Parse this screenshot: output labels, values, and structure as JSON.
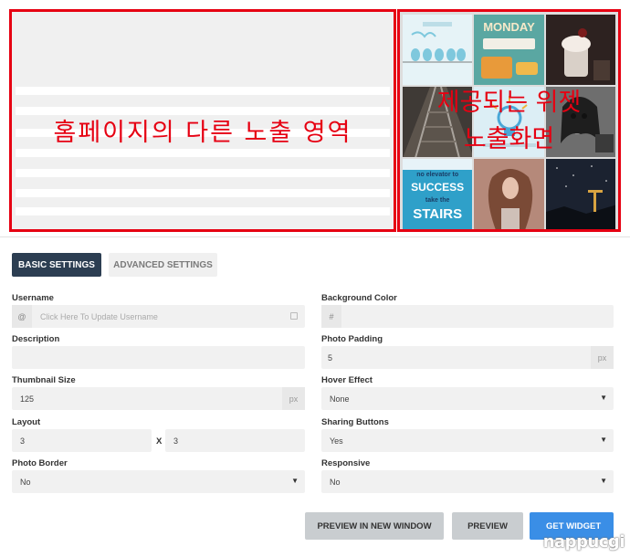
{
  "preview": {
    "placeholder_text": "홈페이지의 다른 노출 영역",
    "widget_overlay_line1": "제공되는 위젯",
    "widget_overlay_line2": "노출화면",
    "tiles": [
      {
        "name": "birds-on-wire",
        "bg": "#e6f3f7"
      },
      {
        "name": "monday-sign",
        "bg": "#5aa7a2",
        "text": "MONDAY"
      },
      {
        "name": "dessert-cup",
        "bg": "#2d2220"
      },
      {
        "name": "railway-tracks",
        "bg": "#3f3a36"
      },
      {
        "name": "lightbulb",
        "bg": "#dceef5"
      },
      {
        "name": "woman-portrait",
        "bg": "#8a8a8a"
      },
      {
        "name": "stairs-quote",
        "bg": "#2fa0c9",
        "text1": "no elevator to",
        "text2": "SUCCESS",
        "text3": "take the",
        "text4": "STAIRS"
      },
      {
        "name": "woman-hair",
        "bg": "#9a6b5a"
      },
      {
        "name": "night-sky",
        "bg": "#1b2230"
      }
    ]
  },
  "tabs": {
    "basic": "BASIC SETTINGS",
    "advanced": "ADVANCED SETTINGS"
  },
  "form": {
    "username": {
      "label": "Username",
      "prefix": "@",
      "placeholder": "Click Here To Update Username"
    },
    "background_color": {
      "label": "Background Color",
      "prefix": "#",
      "value": ""
    },
    "description": {
      "label": "Description",
      "value": ""
    },
    "photo_padding": {
      "label": "Photo Padding",
      "value": "5",
      "unit": "px"
    },
    "thumbnail_size": {
      "label": "Thumbnail Size",
      "value": "125",
      "unit": "px"
    },
    "hover_effect": {
      "label": "Hover Effect",
      "value": "None"
    },
    "layout": {
      "label": "Layout",
      "cols": "3",
      "separator": "X",
      "rows": "3"
    },
    "sharing_buttons": {
      "label": "Sharing Buttons",
      "value": "Yes"
    },
    "photo_border": {
      "label": "Photo Border",
      "value": "No"
    },
    "responsive": {
      "label": "Responsive",
      "value": "No"
    }
  },
  "buttons": {
    "preview_new_window": "PREVIEW IN NEW WINDOW",
    "preview": "PREVIEW",
    "get_widget": "GET WIDGET"
  },
  "watermark": "nappucgi",
  "colors": {
    "highlight_red": "#e60012",
    "tab_active": "#2c3e52",
    "button_primary": "#3a8ee6",
    "button_secondary": "#c9cdd0"
  }
}
